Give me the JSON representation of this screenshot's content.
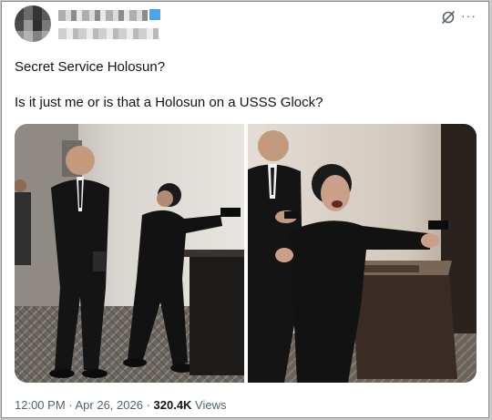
{
  "post": {
    "title": "Secret Service Holosun?",
    "body": "Is it just me or is that a Holosun on a USSS Glock?"
  },
  "meta": {
    "time": "12:00 PM",
    "separator": " · ",
    "date": "Apr 26, 2026",
    "views_count": "320.4K",
    "views_label": " Views"
  },
  "icons": {
    "grok": "grok-icon",
    "more": "more-icon",
    "more_glyph": "···"
  },
  "colors": {
    "text": "#0f1419",
    "secondary": "#536471",
    "verified": "#4da3f0"
  }
}
